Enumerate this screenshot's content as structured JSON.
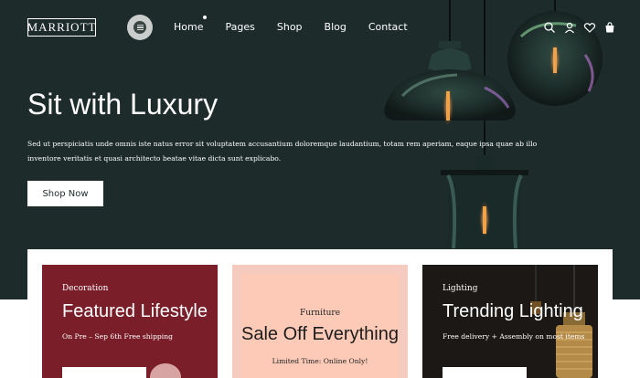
{
  "brand": {
    "logo": "MARRIOTT"
  },
  "nav": {
    "items": [
      {
        "label": "Home",
        "active": true
      },
      {
        "label": "Pages"
      },
      {
        "label": "Shop"
      },
      {
        "label": "Blog"
      },
      {
        "label": "Contact"
      }
    ]
  },
  "header_icons": [
    "search-icon",
    "user-icon",
    "heart-icon",
    "bag-icon"
  ],
  "hero": {
    "title": "Sit with Luxury",
    "text": "Sed ut perspiciatis unde omnis iste natus error sit voluptatem accusantium doloremque laudantium, totam rem aperiam, eaque ipsa quae ab illo inventore veritatis et quasi architecto beatae vitae dicta sunt explicabo.",
    "button": "Shop Now"
  },
  "cards": [
    {
      "eyebrow": "Decoration",
      "title": "Featured Lifestyle",
      "sub": "On Pre – Sep 6th Free shipping"
    },
    {
      "eyebrow": "Furniture",
      "title": "Sale Off Everything",
      "sub": "Limited Time: Online Only!"
    },
    {
      "eyebrow": "Lighting",
      "title": "Trending Lighting",
      "sub": "Free delivery + Assembly on most items"
    }
  ],
  "colors": {
    "hero_bg": "#1d2b2a",
    "card_decoration": "#7a1f2a",
    "card_furniture": "#f6cbbf",
    "card_lighting": "#1b1816"
  }
}
